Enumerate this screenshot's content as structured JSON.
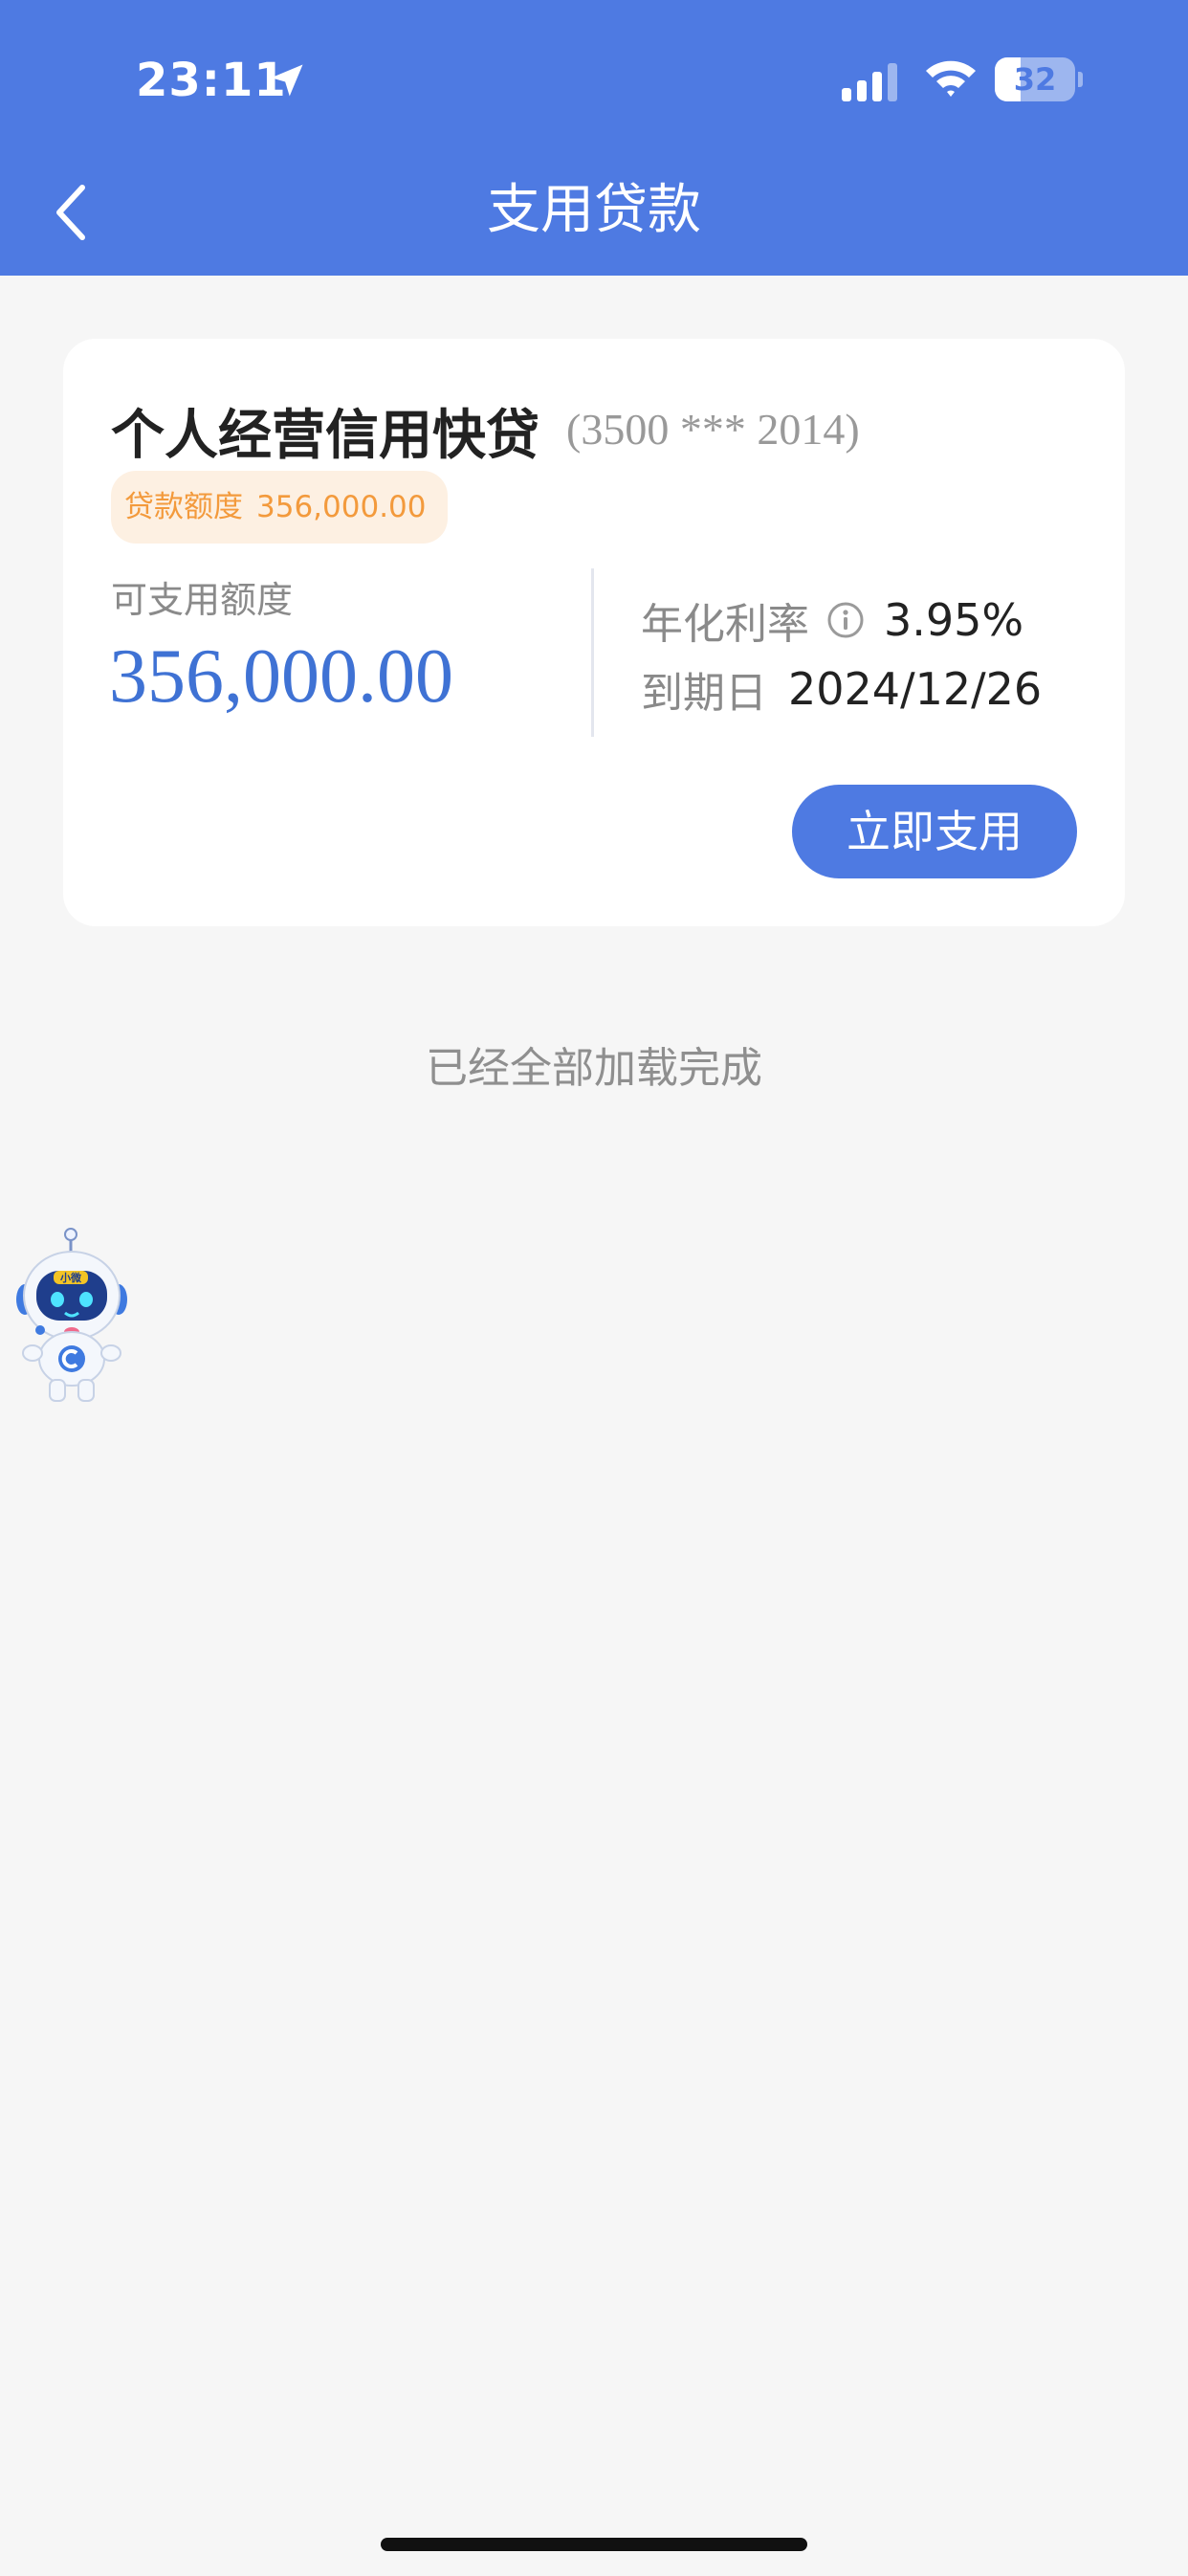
{
  "status_bar": {
    "time": "23:11",
    "battery_level": "32",
    "battery_fraction": 0.32,
    "icons": [
      "location-arrow-icon",
      "signal-icon",
      "wifi-icon",
      "battery-icon"
    ]
  },
  "nav": {
    "back_icon": "chevron-left-icon",
    "title": "支用贷款"
  },
  "loan_card": {
    "product_name": "个人经营信用快贷",
    "account_number": "(3500 *** 2014)",
    "quota_label": "贷款额度",
    "quota_value": "356,000.00",
    "available_label": "可支用额度",
    "available_amount": "356,000.00",
    "rate_label": "年化利率",
    "rate_info_icon": "info-circle-icon",
    "rate_value": "3.95%",
    "due_label": "到期日",
    "due_value": "2024/12/26",
    "use_button_label": "立即支用"
  },
  "list_footer": {
    "load_complete_text": "已经全部加载完成"
  },
  "assistant": {
    "icon": "robot-assistant-icon",
    "badge_text": "小微"
  },
  "colors": {
    "brand_blue": "#4e7ae2",
    "amount_blue": "#3f72d4",
    "badge_orange": "#f39a3c",
    "badge_bg": "#fdf0e2",
    "page_bg": "#f6f6f6"
  }
}
